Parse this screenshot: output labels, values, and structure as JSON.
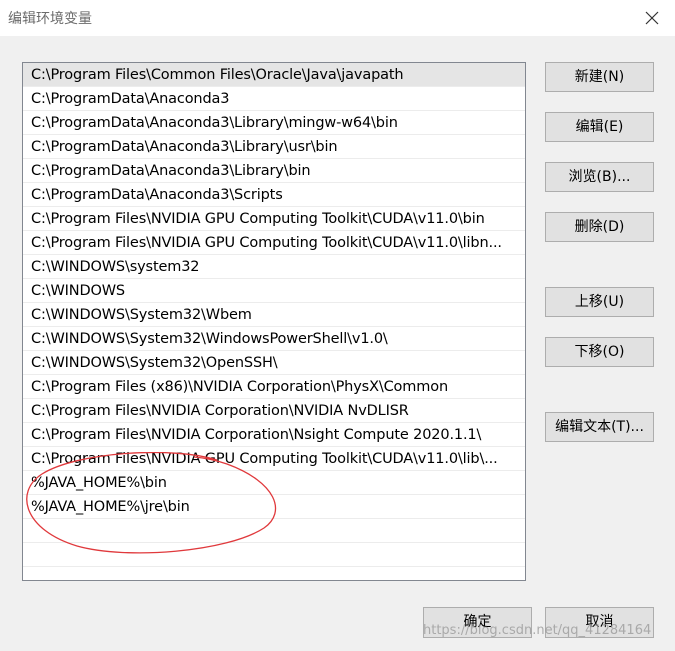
{
  "window": {
    "title": "编辑环境变量",
    "close_icon": "close-icon"
  },
  "path_list": {
    "selected_index": 0,
    "items": [
      "C:\\Program Files\\Common Files\\Oracle\\Java\\javapath",
      "C:\\ProgramData\\Anaconda3",
      "C:\\ProgramData\\Anaconda3\\Library\\mingw-w64\\bin",
      "C:\\ProgramData\\Anaconda3\\Library\\usr\\bin",
      "C:\\ProgramData\\Anaconda3\\Library\\bin",
      "C:\\ProgramData\\Anaconda3\\Scripts",
      "C:\\Program Files\\NVIDIA GPU Computing Toolkit\\CUDA\\v11.0\\bin",
      "C:\\Program Files\\NVIDIA GPU Computing Toolkit\\CUDA\\v11.0\\libn...",
      "C:\\WINDOWS\\system32",
      "C:\\WINDOWS",
      "C:\\WINDOWS\\System32\\Wbem",
      "C:\\WINDOWS\\System32\\WindowsPowerShell\\v1.0\\",
      "C:\\WINDOWS\\System32\\OpenSSH\\",
      "C:\\Program Files (x86)\\NVIDIA Corporation\\PhysX\\Common",
      "C:\\Program Files\\NVIDIA Corporation\\NVIDIA NvDLISR",
      "C:\\Program Files\\NVIDIA Corporation\\Nsight Compute 2020.1.1\\",
      "C:\\Program Files\\NVIDIA GPU Computing Toolkit\\CUDA\\v11.0\\lib\\...",
      "%JAVA_HOME%\\bin",
      "%JAVA_HOME%\\jre\\bin",
      "",
      "",
      ""
    ]
  },
  "buttons": {
    "new": "新建(N)",
    "edit": "编辑(E)",
    "browse": "浏览(B)...",
    "delete": "删除(D)",
    "move_up": "上移(U)",
    "move_down": "下移(O)",
    "edit_text": "编辑文本(T)...",
    "ok": "确定",
    "cancel": "取消"
  },
  "annotation_color": "#e0393c",
  "watermark": "https://blog.csdn.net/qq_41284164"
}
